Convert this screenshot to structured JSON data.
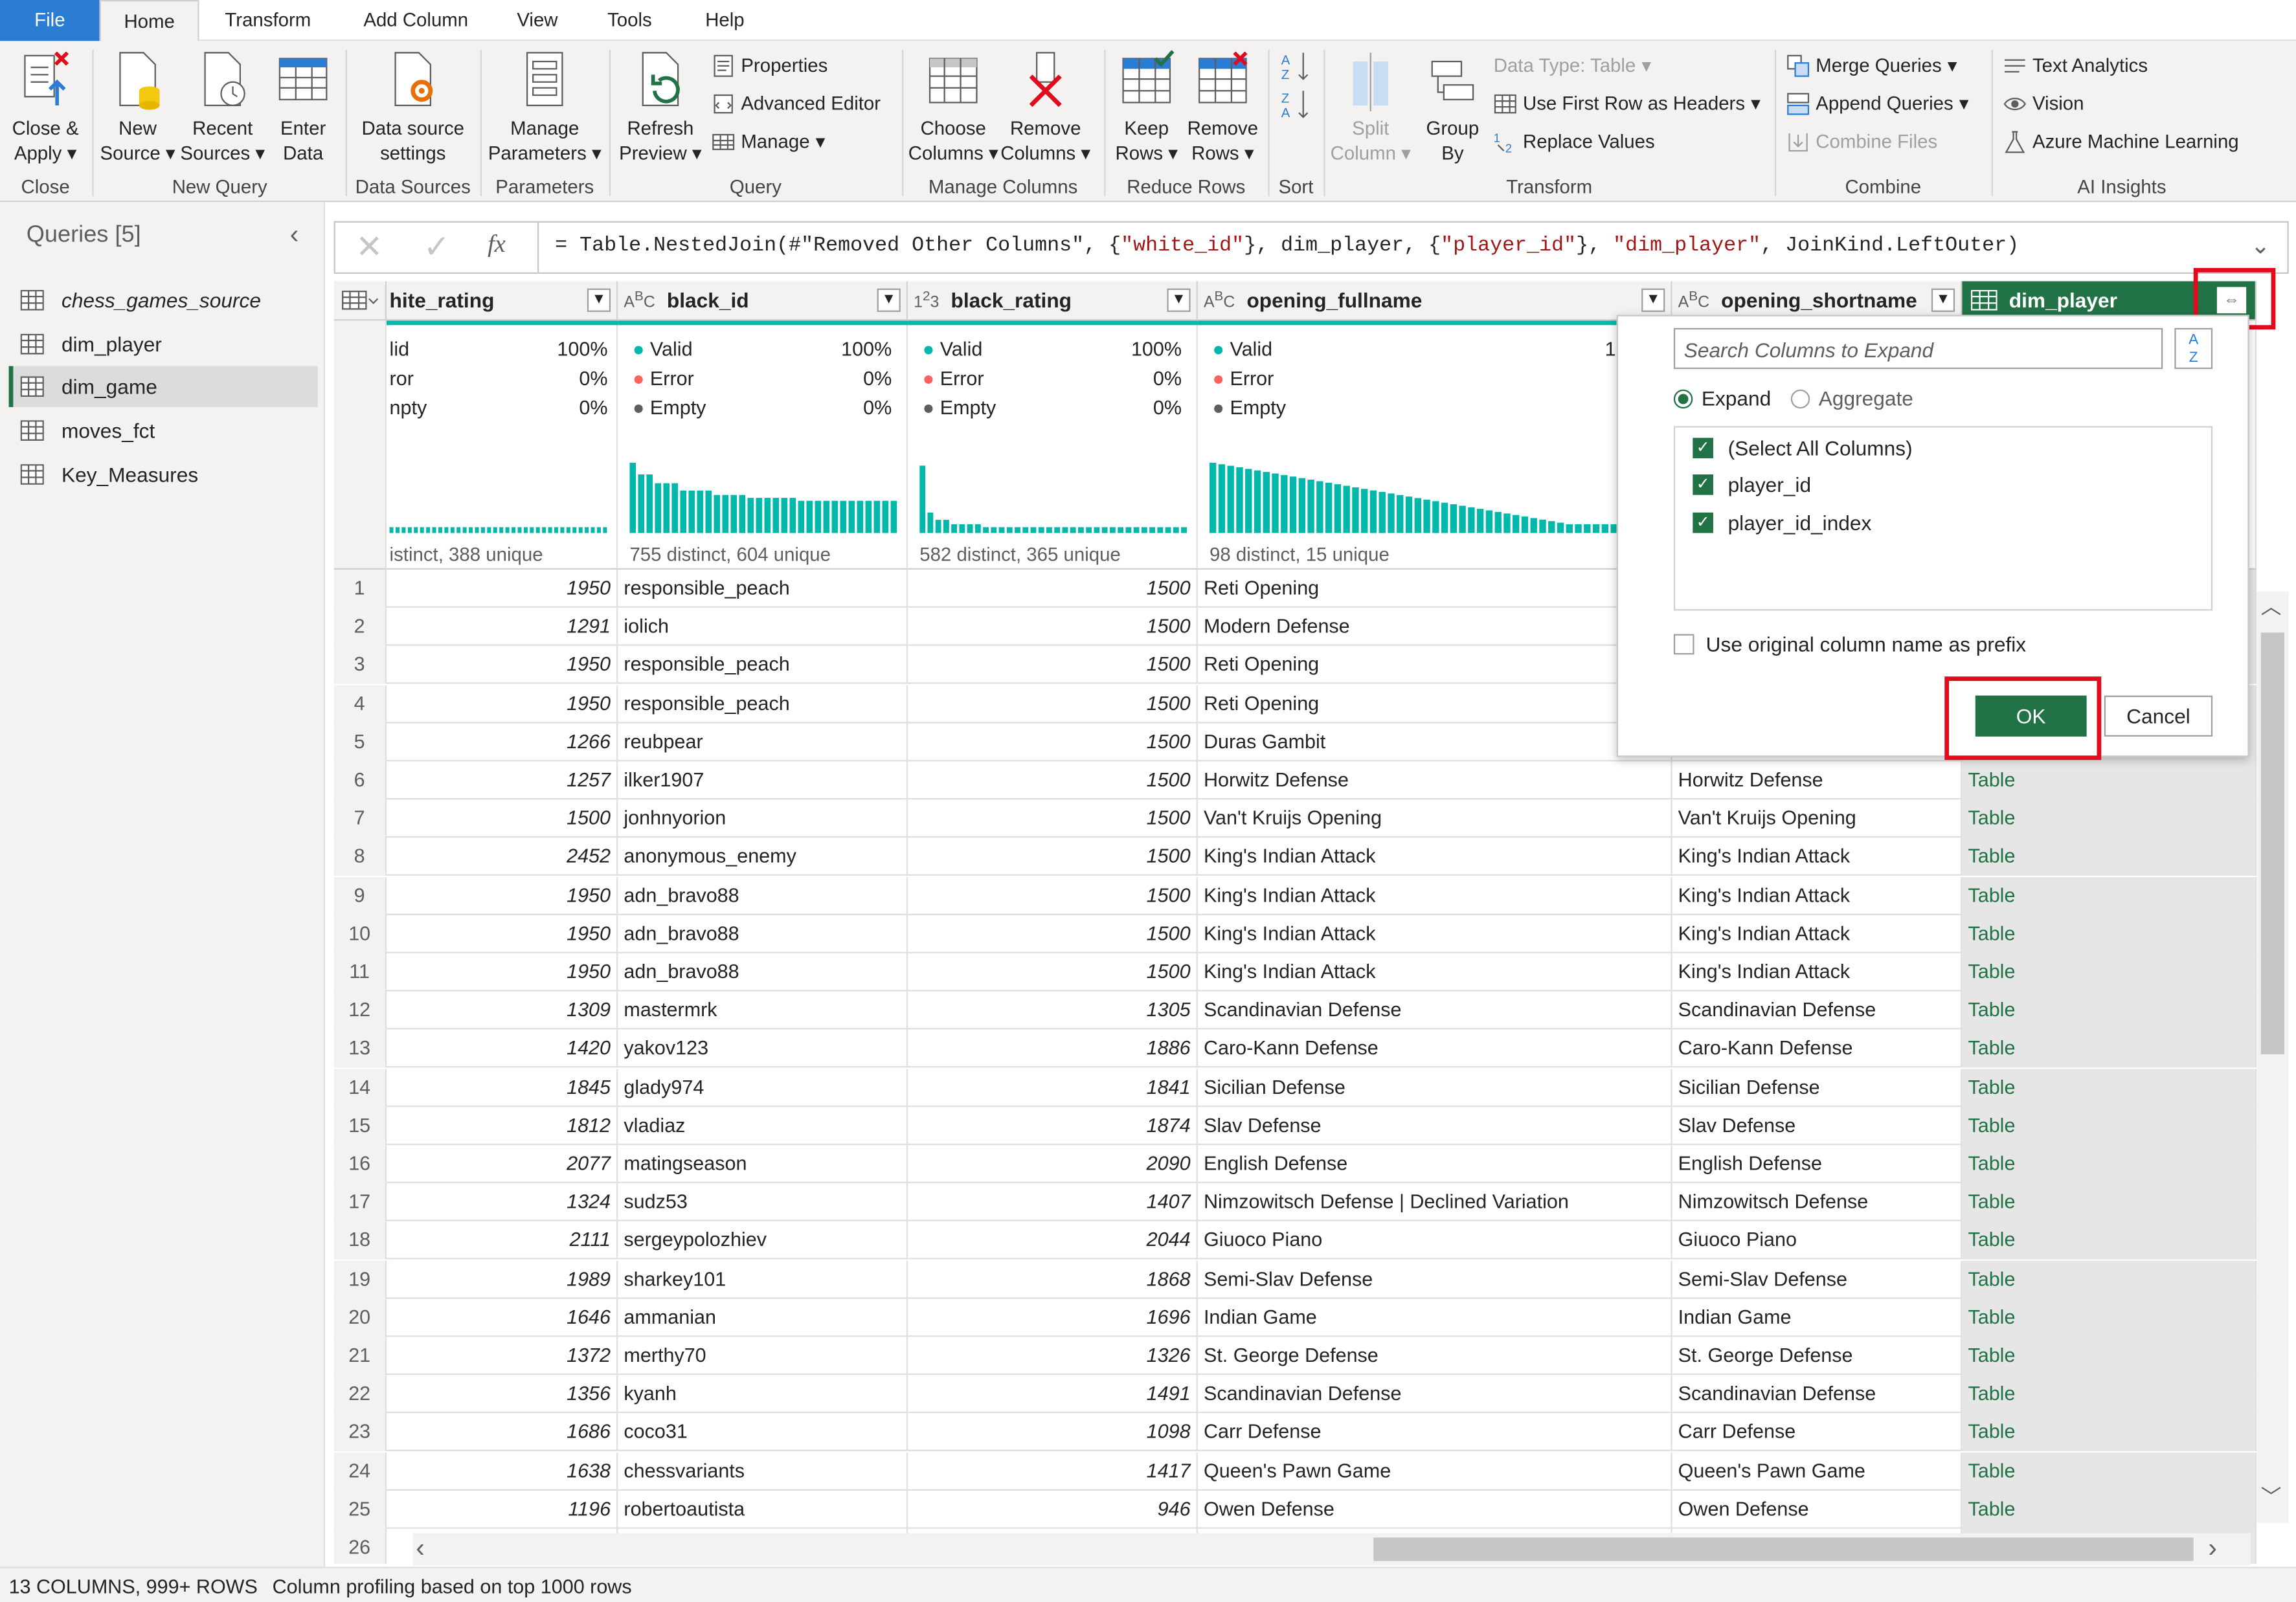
{
  "menu": {
    "tabs": [
      "File",
      "Home",
      "Transform",
      "Add Column",
      "View",
      "Tools",
      "Help"
    ]
  },
  "ribbon": {
    "close_apply": [
      "Close &",
      "Apply"
    ],
    "new_source": [
      "New",
      "Source"
    ],
    "recent_sources": [
      "Recent",
      "Sources"
    ],
    "enter_data": [
      "Enter",
      "Data"
    ],
    "data_source_settings": [
      "Data source",
      "settings"
    ],
    "manage_parameters": [
      "Manage",
      "Parameters"
    ],
    "refresh_preview": [
      "Refresh",
      "Preview"
    ],
    "properties": "Properties",
    "advanced_editor": "Advanced Editor",
    "manage": "Manage",
    "choose_columns": [
      "Choose",
      "Columns"
    ],
    "remove_columns": [
      "Remove",
      "Columns"
    ],
    "keep_rows": [
      "Keep",
      "Rows"
    ],
    "remove_rows": [
      "Remove",
      "Rows"
    ],
    "split_column": [
      "Split",
      "Column"
    ],
    "group_by": [
      "Group",
      "By"
    ],
    "data_type": "Data Type: Table",
    "use_first_row": "Use First Row as Headers",
    "replace_values": "Replace Values",
    "merge_queries": "Merge Queries",
    "append_queries": "Append Queries",
    "combine_files": "Combine Files",
    "text_analytics": "Text Analytics",
    "vision": "Vision",
    "azure_ml": "Azure Machine Learning",
    "groups": [
      "Close",
      "New Query",
      "Data Sources",
      "Parameters",
      "Query",
      "Manage Columns",
      "Reduce Rows",
      "Sort",
      "Transform",
      "Combine",
      "AI Insights"
    ]
  },
  "queries": {
    "title": "Queries [5]",
    "items": [
      "chess_games_source",
      "dim_player",
      "dim_game",
      "moves_fct",
      "Key_Measures"
    ],
    "selected": 2
  },
  "formula": {
    "prefix": "= Table.NestedJoin(#\"Removed Other Columns\", {",
    "s1": "\"white_id\"",
    "m1": "}, dim_player, {",
    "s2": "\"player_id\"",
    "m2": "}, ",
    "s3": "\"dim_player\"",
    "suffix": ", JoinKind.LeftOuter)"
  },
  "columns": [
    {
      "name": "hite_rating",
      "type_icon": "123"
    },
    {
      "name": "black_id",
      "type_icon": "ABC"
    },
    {
      "name": "black_rating",
      "type_icon": "123"
    },
    {
      "name": "opening_fullname",
      "type_icon": "ABC"
    },
    {
      "name": "opening_shortname",
      "type_icon": "ABC"
    },
    {
      "name": "dim_player",
      "type_icon": "table"
    }
  ],
  "profile": {
    "labels": [
      "Valid",
      "Error",
      "Empty"
    ],
    "white_rating": {
      "partial_labels": [
        "lid",
        "ror",
        "npty"
      ],
      "pcts": [
        "100%",
        "0%",
        "0%"
      ],
      "summary": "istinct, 388 unique"
    },
    "black_id": {
      "pcts": [
        "100%",
        "0%",
        "0%"
      ],
      "summary": "755 distinct, 604 unique"
    },
    "black_rating": {
      "pcts": [
        "100%",
        "0%",
        "0%"
      ],
      "summary": "582 distinct, 365 unique"
    },
    "opening_fullname": {
      "pcts": [
        "1"
      ],
      "summary": "98 distinct, 15 unique"
    }
  },
  "rows": [
    [
      "1",
      "1950",
      "responsible_peach",
      "1500",
      "Reti Opening",
      "",
      ""
    ],
    [
      "2",
      "1291",
      "iolich",
      "1500",
      "Modern Defense",
      "",
      ""
    ],
    [
      "3",
      "1950",
      "responsible_peach",
      "1500",
      "Reti Opening",
      "",
      ""
    ],
    [
      "4",
      "1950",
      "responsible_peach",
      "1500",
      "Reti Opening",
      "",
      ""
    ],
    [
      "5",
      "1266",
      "reubpear",
      "1500",
      "Duras Gambit",
      "",
      ""
    ],
    [
      "6",
      "1257",
      "ilker1907",
      "1500",
      "Horwitz Defense",
      "Horwitz Defense",
      "Table"
    ],
    [
      "7",
      "1500",
      "jonhnyorion",
      "1500",
      "Van't Kruijs Opening",
      "Van't Kruijs Opening",
      "Table"
    ],
    [
      "8",
      "2452",
      "anonymous_enemy",
      "1500",
      "King's Indian Attack",
      "King's Indian Attack",
      "Table"
    ],
    [
      "9",
      "1950",
      "adn_bravo88",
      "1500",
      "King's Indian Attack",
      "King's Indian Attack",
      "Table"
    ],
    [
      "10",
      "1950",
      "adn_bravo88",
      "1500",
      "King's Indian Attack",
      "King's Indian Attack",
      "Table"
    ],
    [
      "11",
      "1950",
      "adn_bravo88",
      "1500",
      "King's Indian Attack",
      "King's Indian Attack",
      "Table"
    ],
    [
      "12",
      "1309",
      "mastermrk",
      "1305",
      "Scandinavian Defense",
      "Scandinavian Defense",
      "Table"
    ],
    [
      "13",
      "1420",
      "yakov123",
      "1886",
      "Caro-Kann Defense",
      "Caro-Kann Defense",
      "Table"
    ],
    [
      "14",
      "1845",
      "glady974",
      "1841",
      "Sicilian Defense",
      "Sicilian Defense",
      "Table"
    ],
    [
      "15",
      "1812",
      "vladiaz",
      "1874",
      "Slav Defense",
      "Slav Defense",
      "Table"
    ],
    [
      "16",
      "2077",
      "matingseason",
      "2090",
      "English Defense",
      "English Defense",
      "Table"
    ],
    [
      "17",
      "1324",
      "sudz53",
      "1407",
      "Nimzowitsch Defense |  Declined Variation",
      "Nimzowitsch Defense",
      "Table"
    ],
    [
      "18",
      "2111",
      "sergeypolozhiev",
      "2044",
      "Giuoco Piano",
      "Giuoco Piano",
      "Table"
    ],
    [
      "19",
      "1989",
      "sharkey101",
      "1868",
      "Semi-Slav Defense",
      "Semi-Slav Defense",
      "Table"
    ],
    [
      "20",
      "1646",
      "ammanian",
      "1696",
      "Indian Game",
      "Indian Game",
      "Table"
    ],
    [
      "21",
      "1372",
      "merthy70",
      "1326",
      "St. George Defense",
      "St. George Defense",
      "Table"
    ],
    [
      "22",
      "1356",
      "kyanh",
      "1491",
      "Scandinavian Defense",
      "Scandinavian Defense",
      "Table"
    ],
    [
      "23",
      "1686",
      "coco31",
      "1098",
      "Carr Defense",
      "Carr Defense",
      "Table"
    ],
    [
      "24",
      "1638",
      "chessvariants",
      "1417",
      "Queen's Pawn Game",
      "Queen's Pawn Game",
      "Table"
    ],
    [
      "25",
      "1196",
      "robertoautista",
      "946",
      "Owen Defense",
      "Owen Defense",
      "Table"
    ],
    [
      "26",
      "",
      "",
      "",
      "",
      "",
      ""
    ]
  ],
  "popup": {
    "search_placeholder": "Search Columns to Expand",
    "expand": "Expand",
    "aggregate": "Aggregate",
    "items": [
      "(Select All Columns)",
      "player_id",
      "player_id_index"
    ],
    "prefix_label": "Use original column name as prefix",
    "ok": "OK",
    "cancel": "Cancel"
  },
  "status": {
    "left": "13 COLUMNS, 999+ ROWS",
    "right": "Column profiling based on top 1000 rows"
  },
  "colors": {
    "accent": "#217346",
    "file_tab": "#2b7cd3",
    "valid": "#01b8aa",
    "error": "#fd625e",
    "highlight": "#e00b1c"
  }
}
